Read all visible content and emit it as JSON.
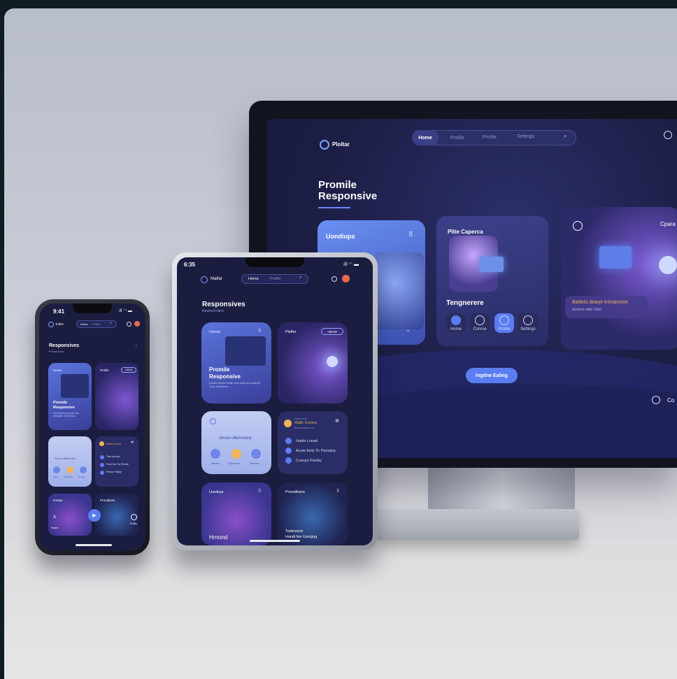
{
  "monitor": {
    "brand": "Ploltar",
    "nav": {
      "home": "Home",
      "profile1": "Profile",
      "profile2": "Profile",
      "settings": "Settings"
    },
    "hero_line1": "Promile",
    "hero_line2": "Responsive",
    "card1_title": "Uondiups",
    "card2_title": "Plite Caperca",
    "card2_sub": "Tengnerere",
    "chips": [
      "Home",
      "Conrse",
      "Profile",
      "Settings"
    ],
    "card3_title": "Cpara",
    "card3_caption": "Battlols doaye trönaicoine",
    "card3_caption_sub": "Acdere olde ISIel",
    "cta": "Ingdne Ealing",
    "corner_text": "Co"
  },
  "tablet": {
    "time": "6:35",
    "brand": "Mattar",
    "nav_home": "Home",
    "nav_profile": "Profile",
    "title": "Responsives",
    "subtitle": "Resnuch tarry",
    "card1_tag": "Uonns",
    "card1_line1": "Promile",
    "card1_line2": "Responsive",
    "card1_desc": "Eoulte fenete solde aurs aide bit ursbergi. Thar somuthan ...",
    "card2_tag": "Plelfer",
    "card2_badge": "+86.00",
    "card3_title": "Atroeo Memolany",
    "card3_icons": [
      "Mobte",
      "Pipermer",
      "Temmo"
    ],
    "list_head_small": "Uenin esk",
    "list_head": "Stsllc Crcons",
    "list_head_sub": "Aoy moland ool",
    "list_items": [
      "Hadie Lonad",
      "Aooie Enty Tir Pamaloy",
      "Cuscpo Panlay"
    ],
    "card5_title": "Uurdeys",
    "card6_title": "Prondihens",
    "card5_bottom": "Hrnond",
    "card6_bottom1": "Todenonol",
    "card6_bottom2": "Hundi fon Usorjiug"
  },
  "phone": {
    "time": "9:41",
    "brand": "Tolltor",
    "nav_home": "Home",
    "nav_profile": "Profile",
    "title": "Responsives",
    "subtitle": "Pomaclumn",
    "card1_tag": "Home",
    "card1_line1": "Promile",
    "card1_line2": "Responsive",
    "card1_desc": "Sond tpom ant sust ous phusioter Thoreesso",
    "card2_tag": "Profile",
    "card2_badge": "+88.00",
    "card3_title": "Roeon Bitia Drkz",
    "card3_icons": [
      "Mobie",
      "Phoromet",
      "Tomme"
    ],
    "list_head": "Exme Ovon",
    "list_items": [
      "Tiad lonwhg",
      "Fuse Ear Tor Pionlat",
      "Ptrand Palitay"
    ],
    "card5_title": "Imolan",
    "card6_title": "Prondtises",
    "bottom_left": "Hnane",
    "bottom_right": "Profile"
  }
}
